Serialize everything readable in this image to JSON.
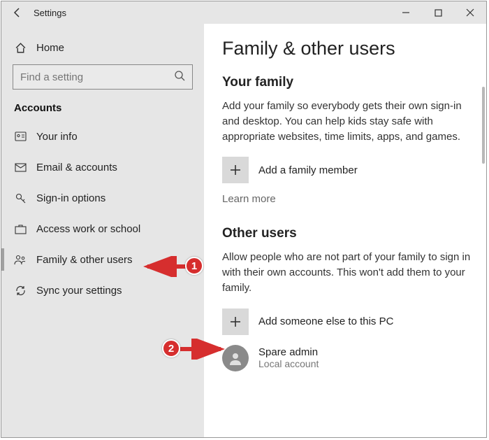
{
  "window": {
    "title": "Settings"
  },
  "sidebar": {
    "home_label": "Home",
    "search_placeholder": "Find a setting",
    "category_label": "Accounts",
    "items": [
      {
        "label": "Your info"
      },
      {
        "label": "Email & accounts"
      },
      {
        "label": "Sign-in options"
      },
      {
        "label": "Access work or school"
      },
      {
        "label": "Family & other users"
      },
      {
        "label": "Sync your settings"
      }
    ]
  },
  "main": {
    "page_title": "Family & other users",
    "family": {
      "heading": "Your family",
      "description": "Add your family so everybody gets their own sign-in and desktop. You can help kids stay safe with appropriate websites, time limits, apps, and games.",
      "add_label": "Add a family member",
      "learn_more": "Learn more"
    },
    "other": {
      "heading": "Other users",
      "description": "Allow people who are not part of your family to sign in with their own accounts. This won't add them to your family.",
      "add_label": "Add someone else to this PC",
      "user_name": "Spare admin",
      "user_type": "Local account"
    }
  },
  "annotations": {
    "step1": "1",
    "step2": "2"
  }
}
